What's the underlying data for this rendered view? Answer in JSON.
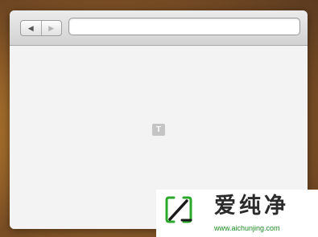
{
  "browser": {
    "back_icon": "left-triangle-icon",
    "forward_icon": "right-triangle-icon",
    "back_glyph": "◀",
    "forward_glyph": "▶",
    "address_value": "",
    "placeholder_icon": "text-plugin-icon",
    "placeholder_glyph": "T"
  },
  "watermark": {
    "title": "爱纯净",
    "url": "www.aichunjing.com",
    "accent_color": "#2aa82a"
  }
}
